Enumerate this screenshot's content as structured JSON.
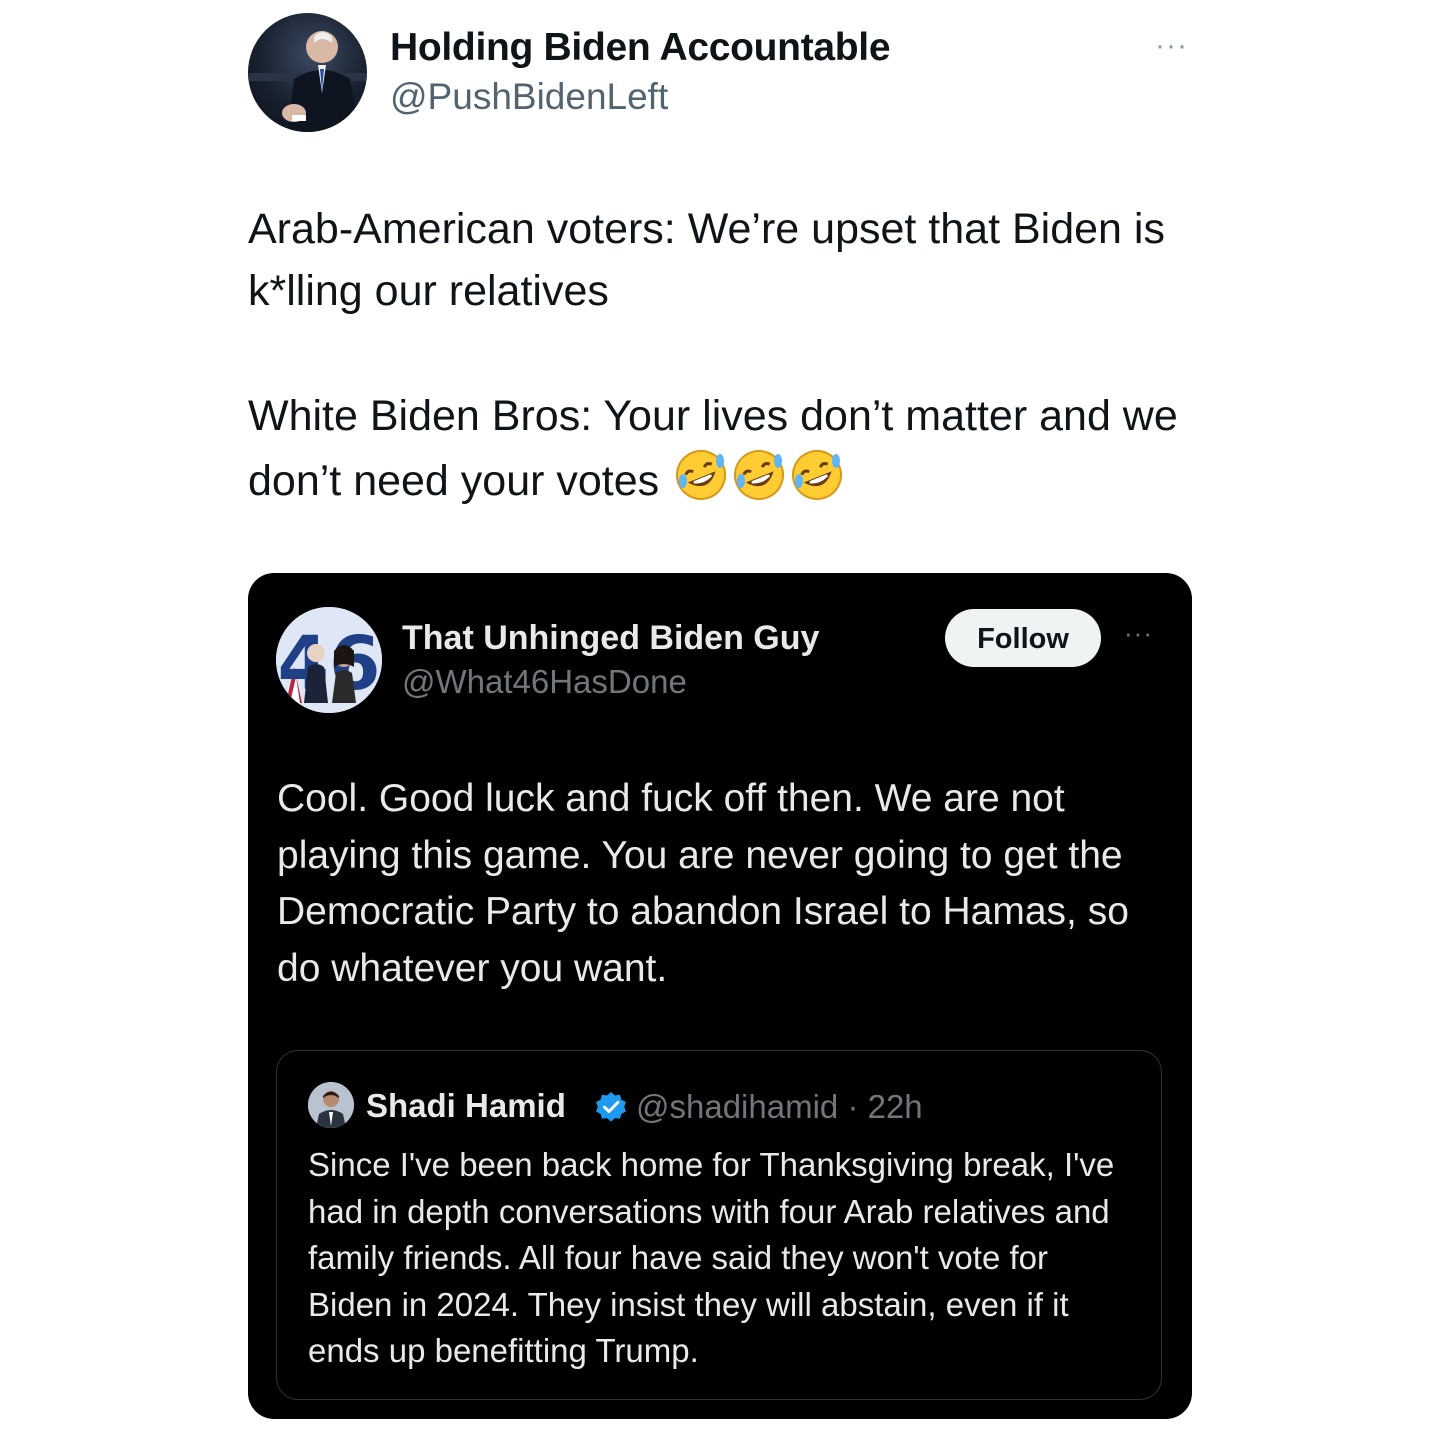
{
  "tweet": {
    "author_name": "Holding Biden Accountable",
    "author_handle": "@PushBidenLeft",
    "more_icon": "···",
    "paragraph_1": "Arab-American voters: We’re upset that Biden is k*lling our relatives",
    "paragraph_2": "White Biden Bros: Your lives don’t matter and we don’t need your votes",
    "emoji_name": "rolling-on-the-floor-laughing",
    "emoji_count": 3
  },
  "card": {
    "author_name": "That Unhinged Biden Guy",
    "author_handle": "@What46HasDone",
    "avatar_text": "46",
    "follow_label": "Follow",
    "more_icon": "···",
    "text": "Cool. Good luck and fuck off then. We are not playing this game. You are never going to get the Democratic Party to abandon Israel to Hamas, so do whatever you want."
  },
  "quote": {
    "author_name": "Shadi Hamid",
    "verified": true,
    "author_handle_time": "@shadihamid · 22h",
    "text": "Since I've been back home for Thanksgiving break, I've  had in depth conversations with four Arab relatives and family friends. All four have said they won't vote for Biden in 2024. They insist they will abstain, even if it ends up benefitting Trump."
  },
  "colors": {
    "text_primary": "#0f1419",
    "text_secondary": "#536471",
    "card_bg": "#000000",
    "card_text": "#e7e9ea",
    "card_secondary": "#71767b",
    "verified_blue": "#1d9bf0"
  }
}
